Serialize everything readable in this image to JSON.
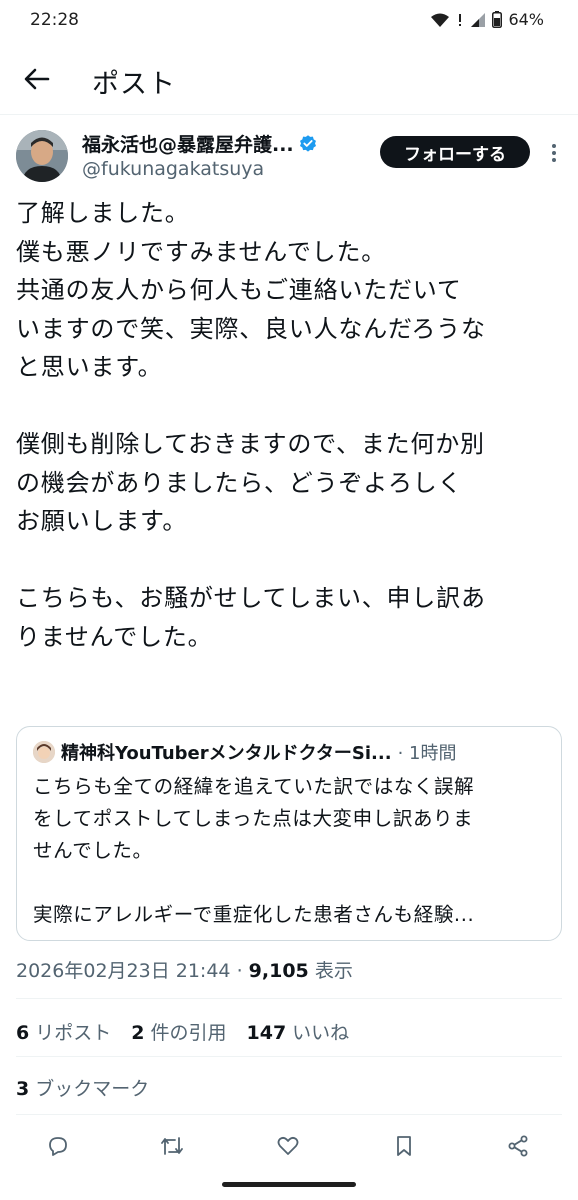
{
  "status_bar": {
    "time": "22:28",
    "battery": "64%"
  },
  "header": {
    "title": "ポスト"
  },
  "author": {
    "name": "福永活也@暴露屋弁護...",
    "handle": "@fukunagakatsuya",
    "follow_label": "フォローする"
  },
  "tweet": {
    "paragraphs": [
      {
        "lines": [
          "了解しました。",
          "僕も悪ノリですみませんでした。",
          "共通の友人から何人もご連絡いただいて",
          "いますので笑、実際、良い人なんだろうな",
          "と思います。"
        ]
      },
      {
        "lines": [
          "僕側も削除しておきますので、また何か別",
          "の機会がありましたら、どうぞよろしく",
          "お願いします。"
        ]
      },
      {
        "lines": [
          "こちらも、お騒がせしてしまい、申し訳あ",
          "りませんでした。"
        ]
      }
    ]
  },
  "quote": {
    "name": "精神科YouTuberメンタルドクターSi...",
    "time": "· 1時間",
    "lines": [
      "こちらも全ての経緯を追えていた訳ではなく誤解",
      "をしてポストしてしまった点は大変申し訳ありま",
      "せんでした。"
    ],
    "lines2": [
      "実際にアレルギーで重症化した患者さんも経験..."
    ]
  },
  "meta": {
    "datetime": "2026年02月23日 21:44",
    "separator": "·",
    "views": "9,105",
    "views_label": "表示"
  },
  "stats": {
    "reposts": "6",
    "reposts_label": "リポスト",
    "quotes": "2",
    "quotes_label": "件の引用",
    "likes": "147",
    "likes_label": "いいね",
    "bookmarks": "3",
    "bookmarks_label": "ブックマーク"
  },
  "actions": [
    "reply-icon",
    "repost-icon",
    "like-icon",
    "bookmark-icon",
    "share-icon"
  ],
  "colors": {
    "text": "#0f1419",
    "secondary": "#536471",
    "verified": "#1d9bf0",
    "border": "#cfd9de"
  }
}
